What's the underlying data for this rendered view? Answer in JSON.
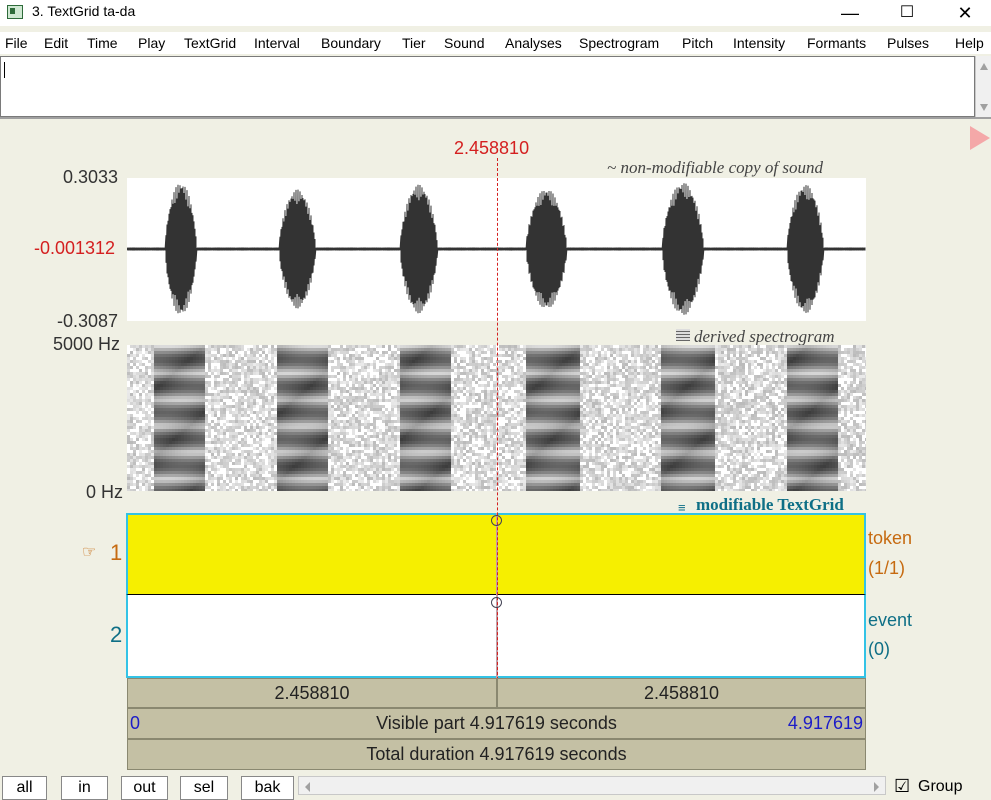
{
  "window": {
    "title": "3. TextGrid ta-da",
    "minimize_glyph": "—",
    "maximize_glyph": "☐",
    "close_glyph": "✕"
  },
  "menu": [
    "File",
    "Edit",
    "Time",
    "Play",
    "TextGrid",
    "Interval",
    "Boundary",
    "Tier",
    "Sound",
    "Analyses",
    "Spectrogram",
    "Pitch",
    "Intensity",
    "Formants",
    "Pulses",
    "Help"
  ],
  "cursor_time": "2.458810",
  "sound": {
    "label": "~ non-modifiable copy of sound",
    "y_max": "0.3033",
    "y_cursor": "-0.001312",
    "y_min": "-0.3087"
  },
  "spectrogram": {
    "label": "derived spectrogram",
    "f_max": "5000 Hz",
    "f_min": "0 Hz"
  },
  "textgrid": {
    "label": "modifiable TextGrid",
    "tiers": [
      {
        "number": "1",
        "pointer": "☞",
        "name": "token",
        "count": "(1/1)"
      },
      {
        "number": "2",
        "name": "event",
        "count": "(0)"
      }
    ]
  },
  "bars": {
    "left_time": "2.458810",
    "right_time": "2.458810",
    "visible_start": "0",
    "visible_text": "Visible part 4.917619 seconds",
    "visible_end": "4.917619",
    "total_text": "Total duration 4.917619 seconds"
  },
  "buttons": {
    "all": "all",
    "in": "in",
    "out": "out",
    "sel": "sel",
    "bak": "bak",
    "group": "Group",
    "group_checked": "☑"
  },
  "colors": {
    "tier_highlight": "#f6ef00",
    "tier_border": "#33c3e6",
    "cursor": "#d42020",
    "tier1_label": "#c66a10",
    "tier2_label": "#0e6f86"
  }
}
